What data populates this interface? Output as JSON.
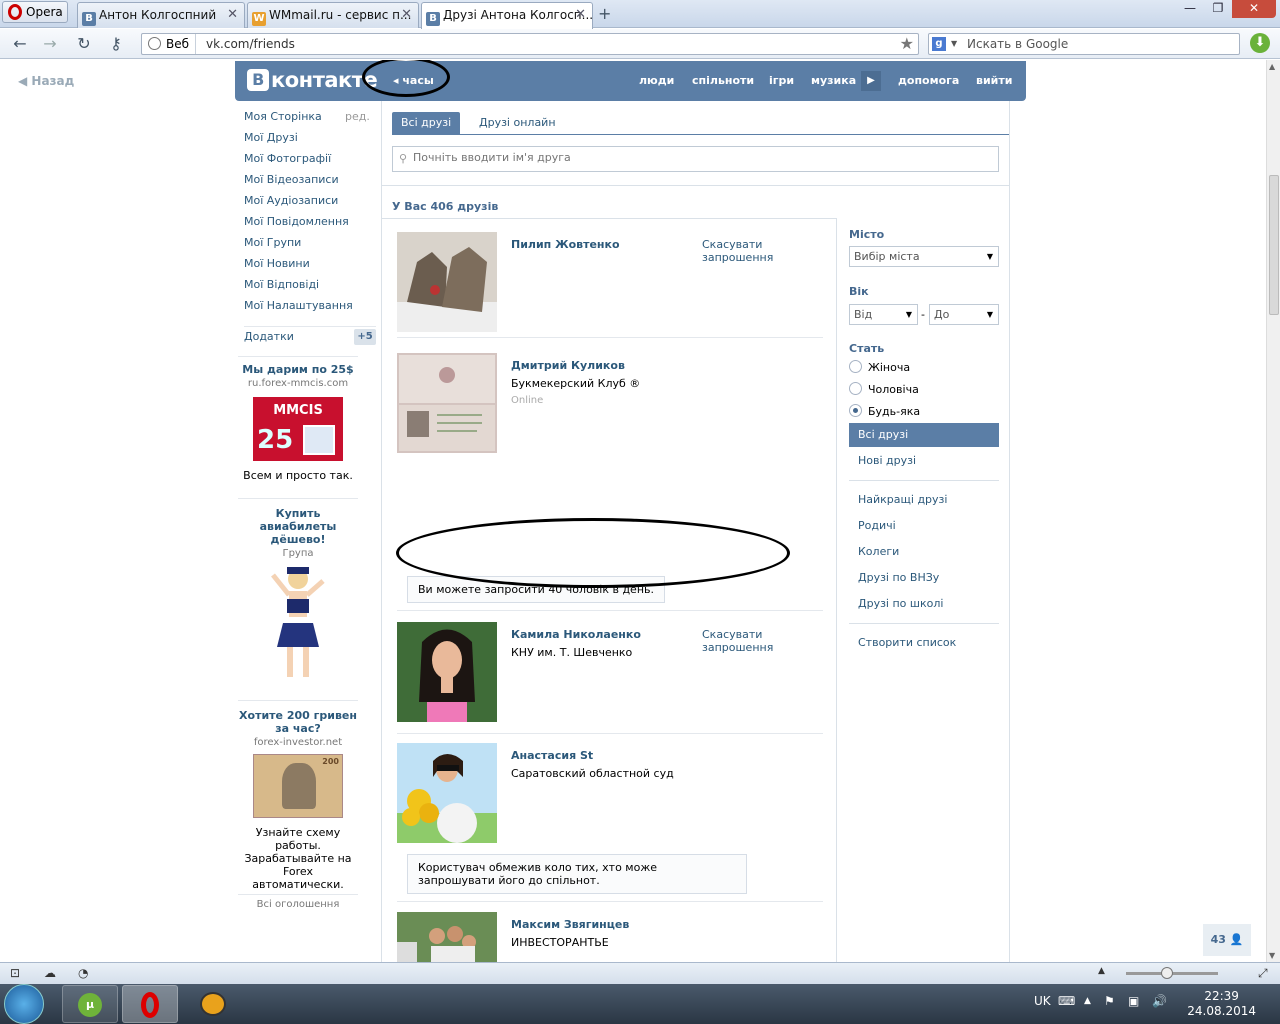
{
  "browser": {
    "menu_label": "Opera",
    "tabs": [
      {
        "title": "Антон Колгоспний",
        "favicon": "В"
      },
      {
        "title": "WMmail.ru - сервис п...",
        "favicon": "W"
      },
      {
        "title": "Друзі Антона Колгосп...",
        "favicon": "В",
        "active": true
      }
    ],
    "address_prefix": "Веб",
    "url": "vk.com/friends",
    "search_placeholder": "Искать в Google",
    "window_controls": [
      "—",
      "❐",
      "✕"
    ]
  },
  "page": {
    "back_label": "Назад",
    "header": {
      "logo_letter": "В",
      "logo_text": "контакте",
      "clock_label": "часы",
      "nav": [
        "люди",
        "спільноти",
        "ігри",
        "музика",
        "допомога",
        "вийти"
      ]
    },
    "left_nav": {
      "edit_label": "ред.",
      "items": [
        "Моя Сторінка",
        "Мої Друзі",
        "Мої Фотографії",
        "Мої Відеозаписи",
        "Мої Аудіозаписи",
        "Мої Повідомлення",
        "Мої Групи",
        "Мої Новини",
        "Мої Відповіді",
        "Мої Налаштування"
      ],
      "apps_label": "Додатки",
      "apps_badge": "+5"
    },
    "ads": [
      {
        "title": "Мы дарим по 25$",
        "domain": "ru.forex-mmcis.com",
        "image_text": "MMCIS",
        "image_num": "25",
        "text": "Всем и просто так."
      },
      {
        "title": "Купить авиабилеты дёшево!",
        "domain": "Група",
        "text": ""
      },
      {
        "title": "Хотите 200 гривен за час?",
        "domain": "forex-investor.net",
        "image_num": "200",
        "text": "Узнайте схему работы. Зарабатывайте на Forex автоматически."
      }
    ],
    "all_ads_label": "Всі оголошення",
    "tabs": {
      "all": "Всі друзі",
      "online": "Друзі онлайн"
    },
    "search_placeholder": "Почніть вводити ім'я друга",
    "friends_count": "У Вас 406 друзів",
    "friends": [
      {
        "name": "Пилип Жовтенко",
        "sub": "",
        "status": "",
        "cancel": "Скасувати запрошення"
      },
      {
        "name": "Дмитрий Куликов",
        "sub": "Букмекерский Клуб ®",
        "status": "Online",
        "cancel": ""
      },
      {
        "name": "Камила Николаенко",
        "sub": "КНУ им. Т. Шевченко",
        "status": "",
        "cancel": "Скасувати запрошення"
      },
      {
        "name": "Анастасия St",
        "sub": "Саратовский областной суд",
        "status": "",
        "cancel": ""
      },
      {
        "name": "Максим Звягинцев",
        "sub": "ИНВЕСТОРАНТЬЕ",
        "status": "",
        "cancel": ""
      }
    ],
    "notice_limit": "Ви можете запросити 40 чоловік в день.",
    "notice_restricted": "Користувач обмежив коло тих, хто може запрошувати його до спільнот.",
    "filters": {
      "city_label": "Місто",
      "city_placeholder": "Вибір міста",
      "age_label": "Вік",
      "age_from": "Від",
      "age_dash": "-",
      "age_to": "До",
      "sex_label": "Стать",
      "sex_options": [
        "Жіноча",
        "Чоловіча",
        "Будь-яка"
      ],
      "sex_selected": "Будь-яка",
      "lists": [
        "Всі друзі",
        "Нові друзі",
        "Найкращі друзі",
        "Родичі",
        "Колеги",
        "Друзі по ВНЗу",
        "Друзі по школі",
        "Створити список"
      ]
    },
    "chat_count": "43"
  },
  "taskbar": {
    "language": "UK",
    "time": "22:39",
    "date": "24.08.2014"
  },
  "colors": {
    "vk_blue": "#5b7ea6",
    "link": "#2b587a"
  }
}
